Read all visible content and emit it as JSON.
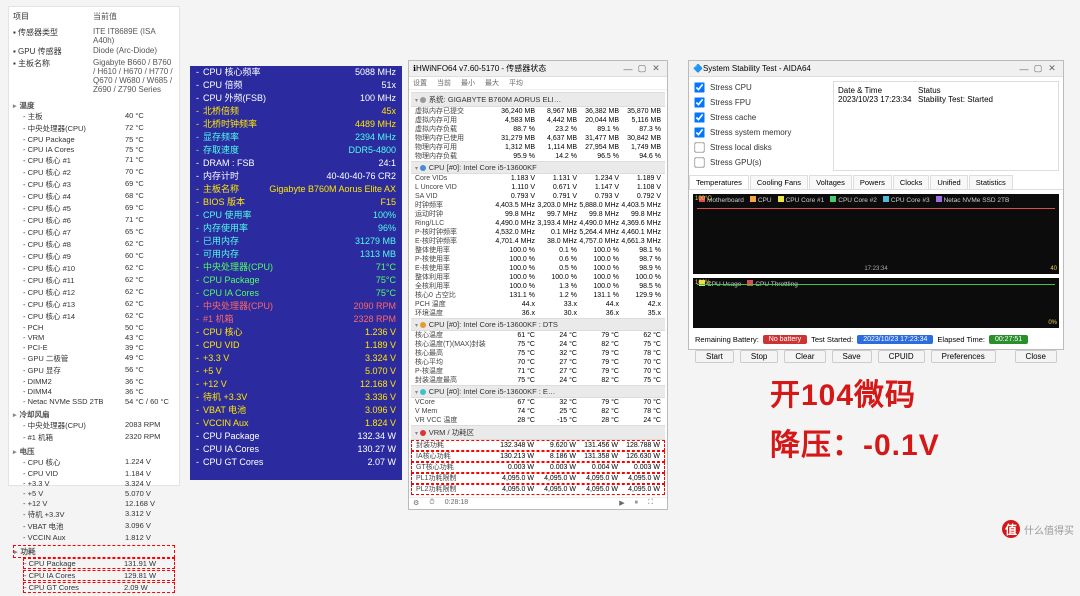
{
  "deviceInfo": {
    "heads": [
      "项目",
      "当前值"
    ],
    "rows": [
      {
        "l": "传感器类型",
        "v": "ITE IT8689E  (ISA A40h)"
      },
      {
        "l": "GPU 传感器",
        "v": "Diode  (Arc-Diode)"
      },
      {
        "l": "主板名称",
        "v": "Gigabyte B660 / B760 / H610 / H670 / H770 / Q670 / W680 / W685 / Z690 / Z790 Series"
      }
    ]
  },
  "tree": {
    "temp_title": "温度",
    "temps": [
      {
        "l": "主板",
        "v": "40 °C"
      },
      {
        "l": "中央处理器(CPU)",
        "v": "72 °C"
      },
      {
        "l": "CPU Package",
        "v": "75 °C"
      },
      {
        "l": "CPU IA Cores",
        "v": "75 °C"
      },
      {
        "l": "CPU 核心 #1",
        "v": "71 °C"
      },
      {
        "l": "CPU 核心 #2",
        "v": "70 °C"
      },
      {
        "l": "CPU 核心 #3",
        "v": "69 °C"
      },
      {
        "l": "CPU 核心 #4",
        "v": "68 °C"
      },
      {
        "l": "CPU 核心 #5",
        "v": "69 °C"
      },
      {
        "l": "CPU 核心 #6",
        "v": "71 °C"
      },
      {
        "l": "CPU 核心 #7",
        "v": "65 °C"
      },
      {
        "l": "CPU 核心 #8",
        "v": "62 °C"
      },
      {
        "l": "CPU 核心 #9",
        "v": "60 °C"
      },
      {
        "l": "CPU 核心 #10",
        "v": "62 °C"
      },
      {
        "l": "CPU 核心 #11",
        "v": "62 °C"
      },
      {
        "l": "CPU 核心 #12",
        "v": "62 °C"
      },
      {
        "l": "CPU 核心 #13",
        "v": "62 °C"
      },
      {
        "l": "CPU 核心 #14",
        "v": "62 °C"
      },
      {
        "l": "PCH",
        "v": "50 °C"
      },
      {
        "l": "VRM",
        "v": "43 °C"
      },
      {
        "l": "PCI-E",
        "v": "39 °C"
      },
      {
        "l": "GPU 二极管",
        "v": "49 °C"
      },
      {
        "l": "GPU 显存",
        "v": "56 °C"
      },
      {
        "l": "DIMM2",
        "v": "36 °C"
      },
      {
        "l": "DIMM4",
        "v": "36 °C"
      },
      {
        "l": "Netac NVMe SSD 2TB",
        "v": "54 °C / 60 °C"
      }
    ],
    "fan_title": "冷却风扇",
    "fans": [
      {
        "l": "中央处理器(CPU)",
        "v": "2083 RPM"
      },
      {
        "l": "#1 机箱",
        "v": "2320 RPM"
      }
    ],
    "volt_title": "电压",
    "volts": [
      {
        "l": "CPU 核心",
        "v": "1.224 V"
      },
      {
        "l": "CPU VID",
        "v": "1.184 V"
      },
      {
        "l": "+3.3 V",
        "v": "3.324 V"
      },
      {
        "l": "+5 V",
        "v": "5.070 V"
      },
      {
        "l": "+12 V",
        "v": "12.168 V"
      },
      {
        "l": "待机 +3.3V",
        "v": "3.312 V"
      },
      {
        "l": "VBAT 电池",
        "v": "3.096 V"
      },
      {
        "l": "VCCIN Aux",
        "v": "1.812 V"
      }
    ],
    "pow_title": "功耗",
    "pows": [
      {
        "l": "CPU Package",
        "v": "131.91 W"
      },
      {
        "l": "CPU IA Cores",
        "v": "129.81 W"
      },
      {
        "l": "CPU GT Cores",
        "v": "2.09 W"
      }
    ]
  },
  "blue": [
    {
      "l": "CPU 核心频率",
      "v": "5088 MHz",
      "c": "w"
    },
    {
      "l": "CPU 倍频",
      "v": "51x",
      "c": "w"
    },
    {
      "l": "CPU 外频(FSB)",
      "v": "100 MHz",
      "c": "w"
    },
    {
      "l": "北桥倍频",
      "v": "45x",
      "c": "y"
    },
    {
      "l": "北桥时钟频率",
      "v": "4489 MHz",
      "c": "y"
    },
    {
      "l": "显存频率",
      "v": "2394 MHz",
      "c": "c"
    },
    {
      "l": "存取速度",
      "v": "DDR5-4800",
      "c": "c"
    },
    {
      "l": "DRAM : FSB",
      "v": "24:1",
      "c": "w"
    },
    {
      "l": "内存计时",
      "v": "40-40-40-76 CR2",
      "c": "w"
    },
    {
      "l": "主板名称",
      "v": "Gigabyte B760M Aorus Elite AX",
      "c": "y"
    },
    {
      "l": "BIOS 版本",
      "v": "F15",
      "c": "y"
    },
    {
      "l": "CPU 使用率",
      "v": "100%",
      "c": "c"
    },
    {
      "l": "内存使用率",
      "v": "96%",
      "c": "c"
    },
    {
      "l": "已用内存",
      "v": "31279 MB",
      "c": "c"
    },
    {
      "l": "可用内存",
      "v": "1313 MB",
      "c": "c"
    },
    {
      "l": "中央处理器(CPU)",
      "v": "71°C",
      "c": "g"
    },
    {
      "l": "CPU Package",
      "v": "75°C",
      "c": "g"
    },
    {
      "l": "CPU IA Cores",
      "v": "75°C",
      "c": "g"
    },
    {
      "l": "中央处理器(CPU)",
      "v": "2090 RPM",
      "c": "r"
    },
    {
      "l": "#1 机箱",
      "v": "2328 RPM",
      "c": "r"
    },
    {
      "l": "CPU 核心",
      "v": "1.236 V",
      "c": "y"
    },
    {
      "l": "CPU VID",
      "v": "1.189 V",
      "c": "y"
    },
    {
      "l": "+3.3 V",
      "v": "3.324 V",
      "c": "y"
    },
    {
      "l": "+5 V",
      "v": "5.070 V",
      "c": "y"
    },
    {
      "l": "+12 V",
      "v": "12.168 V",
      "c": "y"
    },
    {
      "l": "待机 +3.3V",
      "v": "3.336 V",
      "c": "y"
    },
    {
      "l": "VBAT 电池",
      "v": "3.096 V",
      "c": "y"
    },
    {
      "l": "VCCIN Aux",
      "v": "1.824 V",
      "c": "y"
    },
    {
      "l": "CPU Package",
      "v": "132.34 W",
      "c": "w"
    },
    {
      "l": "CPU IA Cores",
      "v": "130.27 W",
      "c": "w"
    },
    {
      "l": "CPU GT Cores",
      "v": "2.07 W",
      "c": "w"
    }
  ],
  "hw": {
    "title": "HWiNFO64 v7.60-5170 - 传感器状态",
    "menu": [
      "设置",
      "当前",
      "最小",
      "最大",
      "平均"
    ],
    "groups": [
      {
        "name": "系统: GIGABYTE B760M AORUS ELI…",
        "dot": "d-gy",
        "rows": [
          {
            "n": "虚拟内存已提交",
            "c": "36,240 MB",
            "mi": "8,967 MB",
            "mx": "36,382 MB",
            "av": "35,870 MB"
          },
          {
            "n": "虚拟内存可用",
            "c": "4,583 MB",
            "mi": "4,442 MB",
            "mx": "20,044 MB",
            "av": "5,116 MB"
          },
          {
            "n": "虚拟内存负载",
            "c": "88.7 %",
            "mi": "23.2 %",
            "mx": "89.1 %",
            "av": "87.3 %"
          },
          {
            "n": "物理内存已使用",
            "c": "31,279 MB",
            "mi": "4,637 MB",
            "mx": "31,477 MB",
            "av": "30,842 MB"
          },
          {
            "n": "物理内存可用",
            "c": "1,312 MB",
            "mi": "1,114 MB",
            "mx": "27,954 MB",
            "av": "1,749 MB"
          },
          {
            "n": "物理内存负载",
            "c": "95.9 %",
            "mi": "14.2 %",
            "mx": "96.5 %",
            "av": "94.6 %"
          }
        ]
      },
      {
        "name": "CPU [#0]: Intel Core i5-13600KF",
        "dot": "d-bl",
        "rows": [
          {
            "n": "Core VIDs",
            "c": "1.183 V",
            "mi": "1.131 V",
            "mx": "1.234 V",
            "av": "1.189 V"
          },
          {
            "n": "L Uncore VID",
            "c": "1.110 V",
            "mi": "0.671 V",
            "mx": "1.147 V",
            "av": "1.108 V"
          },
          {
            "n": "SA VID",
            "c": "0.793 V",
            "mi": "0.791 V",
            "mx": "0.793 V",
            "av": "0.792 V"
          },
          {
            "n": "时钟频率",
            "c": "4,403.5 MHz",
            "mi": "3,203.0 MHz",
            "mx": "5,888.0 MHz",
            "av": "4,403.5 MHz"
          },
          {
            "n": "运动时钟",
            "c": "99.8 MHz",
            "mi": "99.7 MHz",
            "mx": "99.8 MHz",
            "av": "99.8 MHz"
          },
          {
            "n": "Ring/LLC",
            "c": "4,490.0 MHz",
            "mi": "3,193.4 MHz",
            "mx": "4,490.0 MHz",
            "av": "4,369.6 MHz"
          },
          {
            "n": "P-核时钟频率",
            "c": "4,532.0 MHz",
            "mi": "0.1 MHz",
            "mx": "5,264.4 MHz",
            "av": "4,460.1 MHz"
          },
          {
            "n": "E-核时钟频率",
            "c": "4,701.4 MHz",
            "mi": "38.0 MHz",
            "mx": "4,757.0 MHz",
            "av": "4,661.3 MHz"
          },
          {
            "n": "整体使用率",
            "c": "100.0 %",
            "mi": "0.1 %",
            "mx": "100.0 %",
            "av": "98.1 %"
          },
          {
            "n": "P-核使用率",
            "c": "100.0 %",
            "mi": "0.6 %",
            "mx": "100.0 %",
            "av": "98.7 %"
          },
          {
            "n": "E-核使用率",
            "c": "100.0 %",
            "mi": "0.5 %",
            "mx": "100.0 %",
            "av": "98.9 %"
          },
          {
            "n": "整体利用率",
            "c": "100.0 %",
            "mi": "100.0 %",
            "mx": "100.0 %",
            "av": "100.0 %"
          },
          {
            "n": "全核利用率",
            "c": "100.0 %",
            "mi": "1.3 %",
            "mx": "100.0 %",
            "av": "98.5 %"
          },
          {
            "n": "核心0 占空比",
            "c": "131.1 %",
            "mi": "1.2 %",
            "mx": "131.1 %",
            "av": "129.9 %"
          },
          {
            "n": "PCH 温度",
            "c": "44.x",
            "mi": "33.x",
            "mx": "44.x",
            "av": "42.x"
          },
          {
            "n": "环境温度",
            "c": "36.x",
            "mi": "30.x",
            "mx": "36.x",
            "av": "35.x"
          }
        ]
      },
      {
        "name": "CPU [#0]: Intel Core i5-13600KF : DTS",
        "dot": "d-or",
        "rows": [
          {
            "n": "核心温度",
            "c": "61 °C",
            "mi": "24 °C",
            "mx": "79 °C",
            "av": "62 °C"
          },
          {
            "n": "核心温度(T)(MAX)封装",
            "c": "75 °C",
            "mi": "24 °C",
            "mx": "82 °C",
            "av": "75 °C"
          },
          {
            "n": "核心最高",
            "c": "75 °C",
            "mi": "32 °C",
            "mx": "79 °C",
            "av": "78 °C"
          },
          {
            "n": "核心平均",
            "c": "70 °C",
            "mi": "27 °C",
            "mx": "79 °C",
            "av": "70 °C"
          },
          {
            "n": "P-核温度",
            "c": "71 °C",
            "mi": "27 °C",
            "mx": "79 °C",
            "av": "70 °C"
          },
          {
            "n": "封装温度最高",
            "c": "75 °C",
            "mi": "24 °C",
            "mx": "82 °C",
            "av": "75 °C"
          }
        ]
      },
      {
        "name": "CPU [#0]: Intel Core i5-13600KF : E…",
        "dot": "d-cy",
        "rows": [
          {
            "n": "VCore",
            "c": "67 °C",
            "mi": "32 °C",
            "mx": "79 °C",
            "av": "70 °C"
          },
          {
            "n": "V Mem",
            "c": "74 °C",
            "mi": "25 °C",
            "mx": "82 °C",
            "av": "78 °C"
          },
          {
            "n": "VR VCC 温度",
            "c": "28 °C",
            "mi": "-15 °C",
            "mx": "28 °C",
            "av": "24 °C"
          }
        ]
      },
      {
        "name": "VRM / 功耗区",
        "dot": "d-rd",
        "hot": true,
        "rows": [
          {
            "n": "封装功耗",
            "c": "132.348 W",
            "mi": "9.620 W",
            "mx": "131.456 W",
            "av": "128.788 W"
          },
          {
            "n": "IA核心功耗",
            "c": "130.213 W",
            "mi": "8.186 W",
            "mx": "131.358 W",
            "av": "126.630 W"
          },
          {
            "n": "GT核心功耗",
            "c": "0.003 W",
            "mi": "0.003 W",
            "mx": "0.004 W",
            "av": "0.003 W"
          },
          {
            "n": "PL1功耗限制",
            "c": "4,095.0 W",
            "mi": "4,095.0 W",
            "mx": "4,095.0 W",
            "av": "4,095.0 W"
          },
          {
            "n": "PL2功耗限制",
            "c": "4,095.0 W",
            "mi": "4,095.0 W",
            "mx": "4,095.0 W",
            "av": "4,095.0 W"
          }
        ]
      }
    ],
    "status": "0:28:18"
  },
  "aida": {
    "title": "System Stability Test - AIDA64",
    "checks": [
      {
        "l": "Stress CPU",
        "on": true
      },
      {
        "l": "Stress FPU",
        "on": true
      },
      {
        "l": "Stress cache",
        "on": true
      },
      {
        "l": "Stress system memory",
        "on": true
      },
      {
        "l": "Stress local disks",
        "on": false
      },
      {
        "l": "Stress GPU(s)",
        "on": false
      }
    ],
    "stat_head": [
      "Date & Time",
      "Status"
    ],
    "stat_row": [
      "2023/10/23 17:23:34",
      "Stability Test: Started"
    ],
    "tabs": [
      "Temperatures",
      "Cooling Fans",
      "Voltages",
      "Powers",
      "Clocks",
      "Unified",
      "Statistics"
    ],
    "legend1": [
      {
        "c": "#d94f4f",
        "t": "Motherboard"
      },
      {
        "c": "#f4a742",
        "t": "CPU"
      },
      {
        "c": "#e7e34a",
        "t": "CPU Core #1"
      },
      {
        "c": "#4acb6f",
        "t": "CPU Core #2"
      },
      {
        "c": "#4dbbd9",
        "t": "CPU Core #3"
      },
      {
        "c": "#9c6fe4",
        "t": "Netac NVMe SSD 2TB"
      }
    ],
    "y1": [
      "100°C",
      "40"
    ],
    "time1": "17:23:34",
    "legend2": [
      {
        "c": "#e7e34a",
        "t": "CPU Usage"
      },
      {
        "c": "#d94f4f",
        "t": "CPU Throttling"
      }
    ],
    "y2": [
      "100%",
      "0%"
    ],
    "foot": {
      "lab": "Remaining Battery:",
      "p1": "No battery",
      "lab2": "Test Started:",
      "p2": "2023/10/23 17:23:34",
      "lab3": "Elapsed Time:",
      "p3": "00:27:51"
    },
    "btns": [
      "Start",
      "Stop",
      "Clear",
      "Save",
      "CPUID",
      "Preferences",
      "Close"
    ]
  },
  "overlay": {
    "l1": "开104微码",
    "l2": "降压：-0.1V"
  },
  "wmark": "什么值得买"
}
